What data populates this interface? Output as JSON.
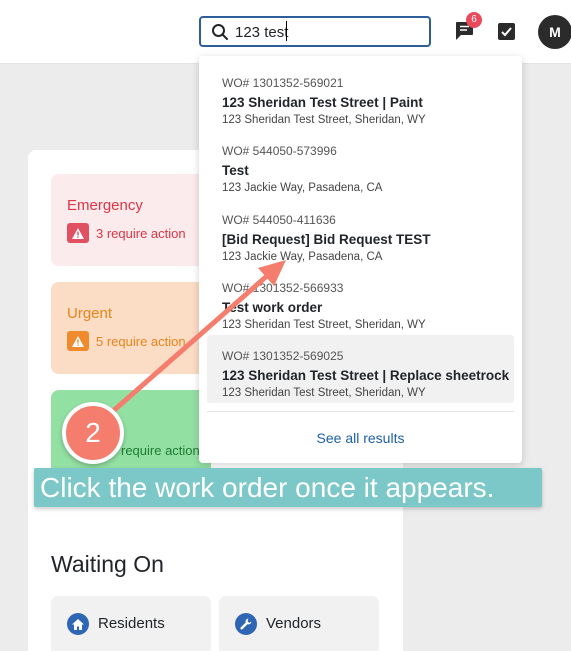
{
  "header": {
    "search_value": "123 test",
    "notifications_count": "6",
    "avatar_initial": "M"
  },
  "cards": {
    "emergency": {
      "title": "Emergency",
      "action": "3 require action"
    },
    "urgent": {
      "title": "Urgent",
      "action": "5 require action"
    },
    "third": {
      "action": "require action"
    }
  },
  "waiting": {
    "title": "Waiting On",
    "items": [
      {
        "label": "Residents",
        "icon": "home-icon"
      },
      {
        "label": "Vendors",
        "icon": "wrench-icon"
      }
    ]
  },
  "search_results": [
    {
      "wo": "WO# 1301352-569021",
      "title": "123 Sheridan Test Street | Paint",
      "address": "123 Sheridan Test Street, Sheridan, WY"
    },
    {
      "wo": "WO# 544050-573996",
      "title": "Test",
      "address": "123 Jackie Way, Pasadena, CA"
    },
    {
      "wo": "WO# 544050-411636",
      "title": "[Bid Request] Bid Request TEST",
      "address": "123 Jackie Way, Pasadena, CA"
    },
    {
      "wo": "WO# 1301352-566933",
      "title": "Test work order",
      "address": "123 Sheridan Test Street, Sheridan, WY"
    },
    {
      "wo": "WO# 1301352-569025",
      "title": "123 Sheridan Test Street | Replace sheetrock",
      "address": "123 Sheridan Test Street, Sheridan, WY"
    }
  ],
  "see_all": "See all results",
  "tutorial": {
    "step": "2",
    "callout": "Click the work order once it appears."
  },
  "colors": {
    "accent": "#1f5ea8",
    "tutorial_marker": "#f47d6e",
    "callout_bg": "#7cc7c7"
  }
}
